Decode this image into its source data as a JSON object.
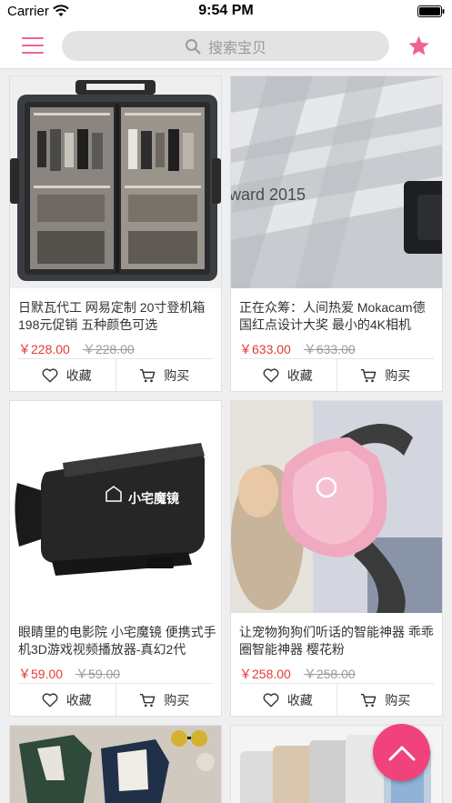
{
  "status_bar": {
    "carrier": "Carrier",
    "time": "9:54 PM"
  },
  "header": {
    "search_placeholder": "搜索宝贝"
  },
  "products": [
    {
      "title": "日默瓦代工 网易定制 20寸登机箱198元促销 五种颜色可选",
      "price": "￥228.00",
      "original_price": "￥228.00",
      "favorite_label": "收藏",
      "buy_label": "购买"
    },
    {
      "title": "正在众筹：人间热爱 Mokacam德国红点设计大奖 最小的4K相机",
      "price": "￥633.00",
      "original_price": "￥633.00",
      "favorite_label": "收藏",
      "buy_label": "购买",
      "image_text": "ward 2015"
    },
    {
      "title": "眼睛里的电影院 小宅魔镜 便携式手机3D游戏视频播放器-真幻2代",
      "price": "￥59.00",
      "original_price": "￥59.00",
      "favorite_label": "收藏",
      "buy_label": "购买",
      "image_text": "小宅魔镜"
    },
    {
      "title": "让宠物狗狗们听话的智能神器 乖乖圈智能神器 樱花粉",
      "price": "￥258.00",
      "original_price": "￥258.00",
      "favorite_label": "收藏",
      "buy_label": "购买"
    }
  ],
  "colors": {
    "accent": "#f06292",
    "price": "#e53935",
    "fab": "#f0437c"
  },
  "icons": {
    "menu": "menu-icon",
    "search": "search-icon",
    "favorite_star": "star-icon",
    "heart": "heart-icon",
    "cart": "cart-icon",
    "back_to_top": "chevron-up-icon"
  }
}
